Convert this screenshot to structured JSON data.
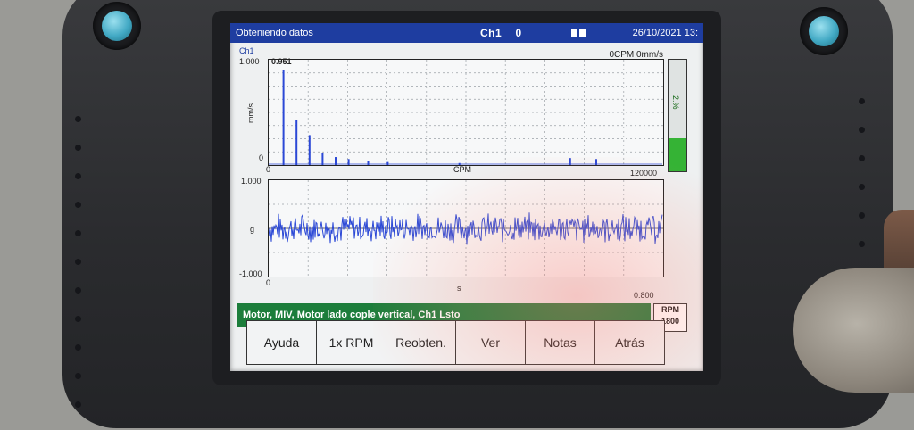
{
  "titlebar": {
    "status": "Obteniendo datos",
    "channel": "Ch1",
    "channel_value": "0",
    "datetime": "26/10/2021 13:"
  },
  "spectrum": {
    "channel_tag": "Ch1",
    "speed_readout": "0CPM  0mm/s",
    "peak_value": "0.951",
    "y_max": "1.000",
    "y_min": "0",
    "y_unit": "mm/s",
    "x_min": "0",
    "x_label": "CPM",
    "x_max": "120000"
  },
  "waveform": {
    "y_max": "1.000",
    "y_min": "-1.000",
    "y_unit": "g",
    "x_min": "0",
    "x_label": "s",
    "x_max": "0.800"
  },
  "gauge": {
    "label": "2.%",
    "level": 0.3
  },
  "message": "Motor, MIV, Motor lado cople vertical, Ch1 Lsto",
  "rpm": {
    "label": "RPM",
    "value": "1800"
  },
  "softkeys": [
    "Ayuda",
    "1x RPM",
    "Reobten.",
    "Ver",
    "Notas",
    "Atrás"
  ],
  "colors": {
    "titlebar": "#1e3da0",
    "message_bar": "#1c7d3b",
    "trace": "#2b48d6",
    "gauge_fill": "#35b335",
    "knob_cap": "#42a9c4"
  },
  "chart_data": [
    {
      "type": "bar",
      "x": [
        4000,
        8000,
        12000,
        16000,
        20000,
        24000,
        30000,
        36000,
        58000,
        92000,
        100000
      ],
      "values": [
        0.951,
        0.45,
        0.3,
        0.12,
        0.08,
        0.06,
        0.04,
        0.03,
        0.02,
        0.07,
        0.06
      ],
      "xlim": [
        0,
        120000
      ],
      "ylim": [
        0,
        1.0
      ],
      "xlabel": "CPM",
      "ylabel": "mm/s"
    },
    {
      "type": "line",
      "xlim": [
        0,
        0.8
      ],
      "ylim": [
        -1.0,
        1.0
      ],
      "xlabel": "s",
      "ylabel": "g",
      "envelope": {
        "upper": 0.3,
        "lower": -0.3
      }
    }
  ]
}
